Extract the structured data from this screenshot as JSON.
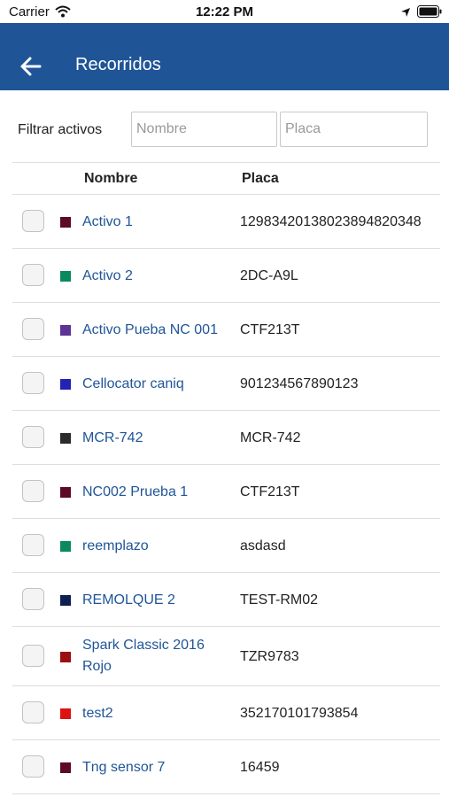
{
  "status_bar": {
    "carrier": "Carrier",
    "time": "12:22 PM"
  },
  "app_bar": {
    "title": "Recorridos",
    "background": "#1f5597"
  },
  "filter": {
    "label": "Filtrar activos",
    "name_placeholder": "Nombre",
    "plate_placeholder": "Placa"
  },
  "table": {
    "headers": {
      "name": "Nombre",
      "plate": "Placa"
    },
    "rows": [
      {
        "color": "#5c0a26",
        "name": "Activo 1",
        "plate": "12983420138023894820348",
        "checked": false
      },
      {
        "color": "#0a8a5c",
        "name": "Activo 2",
        "plate": "2DC-A9L",
        "checked": false
      },
      {
        "color": "#5b3496",
        "name": "Activo Pueba NC 001",
        "plate": "CTF213T",
        "checked": false
      },
      {
        "color": "#2222b4",
        "name": "Cellocator caniq",
        "plate": "901234567890123",
        "checked": false
      },
      {
        "color": "#2b2b2b",
        "name": "MCR-742",
        "plate": "MCR-742",
        "checked": false
      },
      {
        "color": "#5c0a26",
        "name": "NC002 Prueba 1",
        "plate": "CTF213T",
        "checked": false
      },
      {
        "color": "#0a8a5c",
        "name": "reemplazo",
        "plate": "asdasd",
        "checked": false
      },
      {
        "color": "#0e1f52",
        "name": "REMOLQUE 2",
        "plate": "TEST-RM02",
        "checked": false
      },
      {
        "color": "#9a1010",
        "name": "Spark Classic 2016 Rojo",
        "plate": "TZR9783",
        "checked": false
      },
      {
        "color": "#dd1111",
        "name": "test2",
        "plate": "352170101793854",
        "checked": false
      },
      {
        "color": "#5c0a26",
        "name": "Tng sensor 7",
        "plate": "16459",
        "checked": false
      }
    ]
  }
}
